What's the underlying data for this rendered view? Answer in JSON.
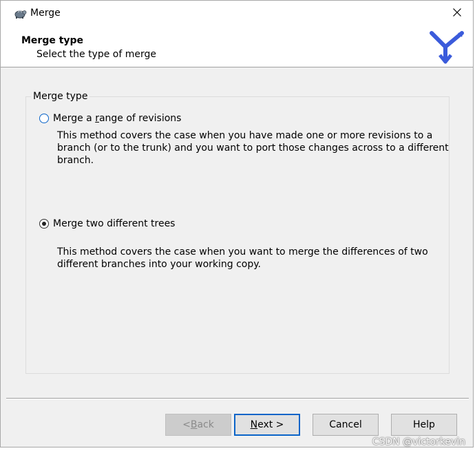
{
  "window": {
    "title": "Merge",
    "icons": {
      "app": "tortoise-icon",
      "close": "close-icon",
      "logo": "merge-arrows-icon"
    }
  },
  "header": {
    "title": "Merge type",
    "subtitle": "Select the type of merge"
  },
  "group": {
    "legend": "Merge type",
    "options": [
      {
        "pre": "Merge a ",
        "accel": "r",
        "post": "ange of revisions",
        "selected": false,
        "description": [
          "This method covers the case when you have made one or more revisions to a",
          "branch (or to the trunk) and you want to port those changes across to a different",
          "branch."
        ]
      },
      {
        "pre": "Merge two different trees",
        "accel": "",
        "post": "",
        "selected": true,
        "description": [
          "This method covers the case when you want to merge the differences of two",
          "different branches into your working copy."
        ]
      }
    ]
  },
  "buttons": {
    "back": {
      "pre": "< ",
      "accel": "B",
      "post": "ack",
      "enabled": false
    },
    "next": {
      "pre": "",
      "accel": "N",
      "post": "ext >",
      "enabled": true
    },
    "cancel": "Cancel",
    "help": "Help"
  },
  "watermark": "CSDN @victorkevin",
  "colors": {
    "accent": "#0a64c8",
    "logo": "#3b5bdb",
    "window_bg": "#f0f0f0"
  }
}
